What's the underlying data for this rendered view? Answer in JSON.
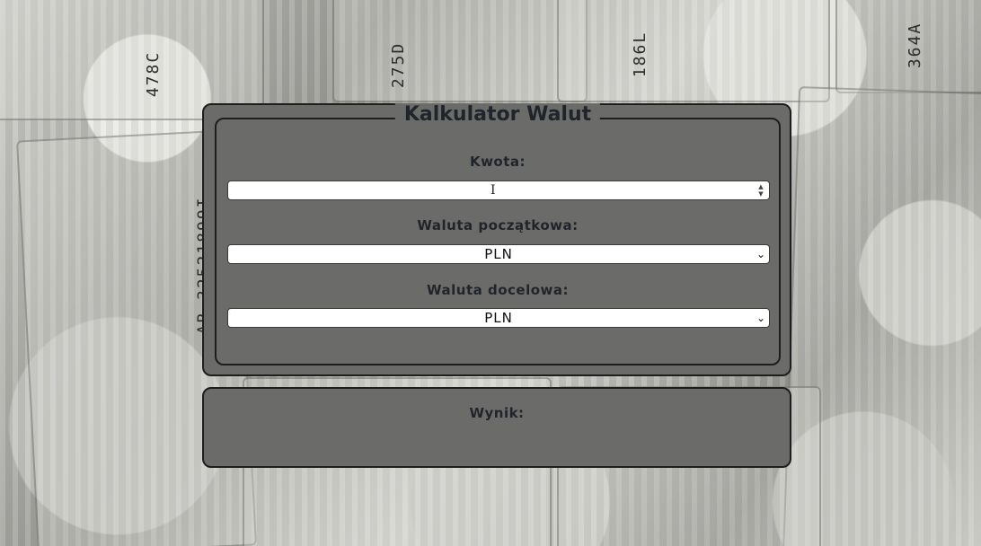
{
  "calculator": {
    "title": "Kalkulator Walut",
    "amount_label": "Kwota:",
    "amount_value": "",
    "from_label": "Waluta początkowa:",
    "from_selected": "PLN",
    "to_label": "Waluta docelowa:",
    "to_selected": "PLN"
  },
  "result": {
    "label": "Wynik:",
    "value": ""
  },
  "background": {
    "serials": [
      "478C",
      "275D",
      "186L",
      "364A",
      "AB 32521899I"
    ]
  },
  "icons": {
    "spinner": "number-spinner-icon",
    "dropdown": "chevron-down-icon",
    "cursor": "text-cursor-icon"
  },
  "colors": {
    "panel": "#6b6b69",
    "border": "#1e1e1e",
    "text": "#1f252b"
  }
}
